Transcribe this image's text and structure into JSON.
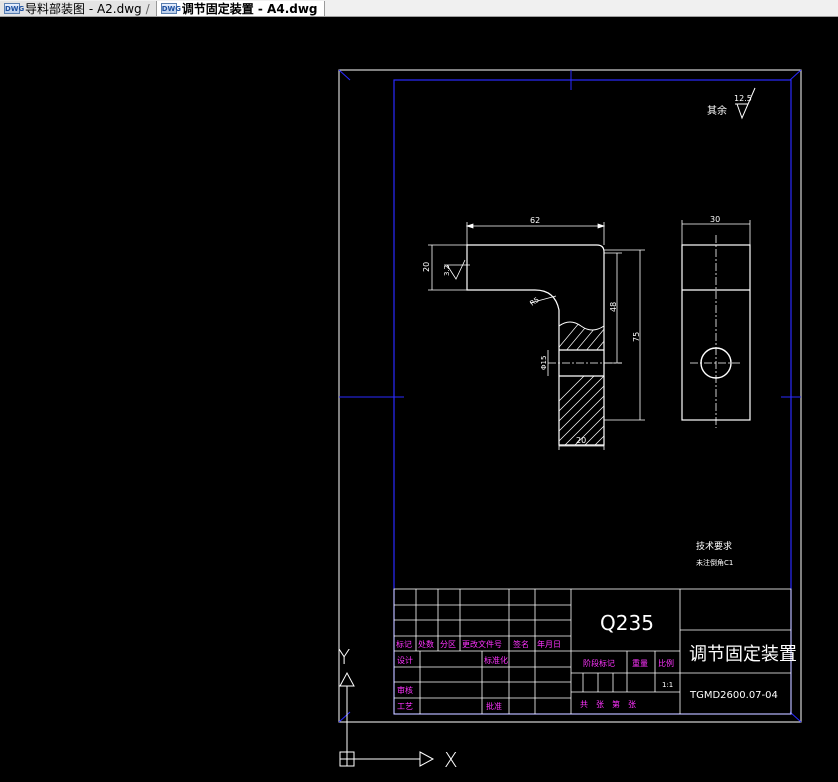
{
  "tabs": [
    {
      "icon": "dwg-file-icon",
      "label": "导料部装图 - A2.dwg",
      "active": false
    },
    {
      "icon": "dwg-file-icon",
      "label": "调节固定装置 - A4.dwg",
      "active": true
    }
  ],
  "drawing": {
    "roughness_note": "其余",
    "roughness_value": "12.5",
    "dims": {
      "top_width": "62",
      "left_height": "20",
      "local_roughness": "3.2",
      "radius": "R5",
      "inner_height": "48",
      "total_height": "75",
      "hole_dia": "Φ15",
      "bottom_width": "20",
      "side_width": "30"
    },
    "tech_title": "技术要求",
    "tech_note": "未注倒角C1"
  },
  "title_block": {
    "material": "Q235",
    "part_name": "调节固定装置",
    "drawing_no": "TGMD2600.07-04",
    "scale": "1:1",
    "labels": {
      "mark": "标记",
      "count": "处数",
      "zone": "分区",
      "change_doc": "更改文件号",
      "signature": "签名",
      "date": "年月日",
      "design": "设计",
      "standard": "标准化",
      "stage_mark": "阶段标记",
      "weight": "重量",
      "ratio": "比例",
      "review": "审核",
      "process": "工艺",
      "approve": "批准",
      "sheets": "共　张　第　张"
    }
  },
  "ucs": {
    "x_label": "X",
    "y_label": "Y"
  }
}
